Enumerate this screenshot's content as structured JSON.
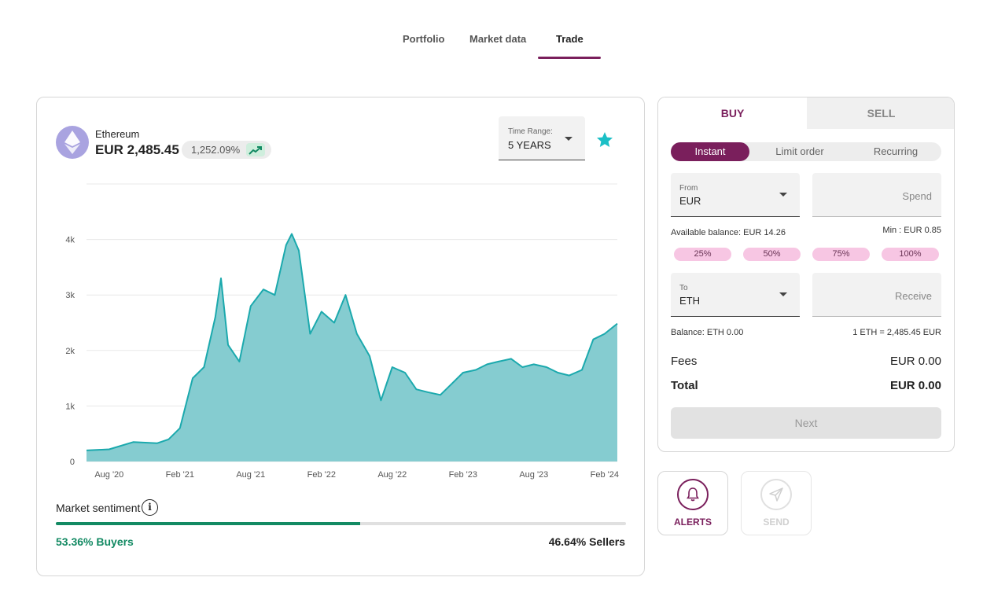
{
  "nav": {
    "tabs": [
      {
        "label": "Portfolio"
      },
      {
        "label": "Market data"
      },
      {
        "label": "Trade"
      }
    ],
    "active": "Trade"
  },
  "asset": {
    "name": "Ethereum",
    "price": "EUR 2,485.45",
    "change": "1,252.09%",
    "icon": "ethereum-logo-icon"
  },
  "time_range": {
    "label": "Time Range:",
    "value": "5 YEARS"
  },
  "chart_data": {
    "type": "area",
    "x": [
      2020.42,
      2020.58,
      2020.75,
      2020.92,
      2021.0,
      2021.08,
      2021.17,
      2021.25,
      2021.33,
      2021.37,
      2021.42,
      2021.5,
      2021.58,
      2021.67,
      2021.75,
      2021.83,
      2021.87,
      2021.92,
      2022.0,
      2022.08,
      2022.17,
      2022.25,
      2022.33,
      2022.42,
      2022.5,
      2022.58,
      2022.67,
      2022.75,
      2022.83,
      2022.92,
      2023.0,
      2023.08,
      2023.17,
      2023.25,
      2023.33,
      2023.42,
      2023.5,
      2023.58,
      2023.67,
      2023.75,
      2023.83,
      2023.92,
      2024.0,
      2024.08,
      2024.17
    ],
    "values": [
      200,
      220,
      350,
      330,
      400,
      600,
      1500,
      1700,
      2600,
      3300,
      2100,
      1800,
      2800,
      3100,
      3000,
      3900,
      4100,
      3800,
      2300,
      2700,
      2500,
      3000,
      2300,
      1900,
      1100,
      1700,
      1600,
      1300,
      1250,
      1200,
      1400,
      1600,
      1650,
      1750,
      1800,
      1850,
      1700,
      1750,
      1700,
      1600,
      1550,
      1650,
      2200,
      2300,
      2485
    ],
    "x_tick_labels": [
      "Aug '20",
      "Feb '21",
      "Aug '21",
      "Feb '22",
      "Aug '22",
      "Feb '23",
      "Aug '23",
      "Feb '24"
    ],
    "x_ticks": [
      2020.58,
      2021.08,
      2021.58,
      2022.08,
      2022.58,
      2023.08,
      2023.58,
      2024.08
    ],
    "y_ticks": [
      0,
      1000,
      2000,
      3000,
      4000
    ],
    "y_tick_labels": [
      "0",
      "1k",
      "2k",
      "3k",
      "4k"
    ],
    "xlim": [
      2020.42,
      2024.17
    ],
    "ylim": [
      0,
      5000
    ],
    "grid": true,
    "colors": {
      "fill": "#85ccd0",
      "line": "#1ba9ad"
    }
  },
  "sentiment": {
    "label": "Market sentiment",
    "info": "i",
    "buyers_pct": 53.36,
    "buyers": "53.36% Buyers",
    "sellers": "46.64% Sellers"
  },
  "trade": {
    "tabs": {
      "buy": "BUY",
      "sell": "SELL"
    },
    "modes": {
      "instant": "Instant",
      "limit": "Limit order",
      "recurring": "Recurring"
    },
    "from": {
      "label": "From",
      "value": "EUR"
    },
    "spend_placeholder": "Spend",
    "available_balance": "Available balance: EUR 14.26",
    "min": "Min : EUR 0.85",
    "percents": [
      "25%",
      "50%",
      "75%",
      "100%"
    ],
    "to": {
      "label": "To",
      "value": "ETH"
    },
    "receive_placeholder": "Receive",
    "balance": "Balance: ETH 0.00",
    "rate": "1 ETH = 2,485.45 EUR",
    "fees_label": "Fees",
    "fees_value": "EUR 0.00",
    "total_label": "Total",
    "total_value": "EUR 0.00",
    "next_label": "Next"
  },
  "actions": {
    "alerts": "ALERTS",
    "send": "SEND"
  },
  "colors": {
    "brand": "#7a1f5c",
    "buyers": "#138a63",
    "percent_chip": "#f7c6e3",
    "star": "#1bbfc6"
  }
}
